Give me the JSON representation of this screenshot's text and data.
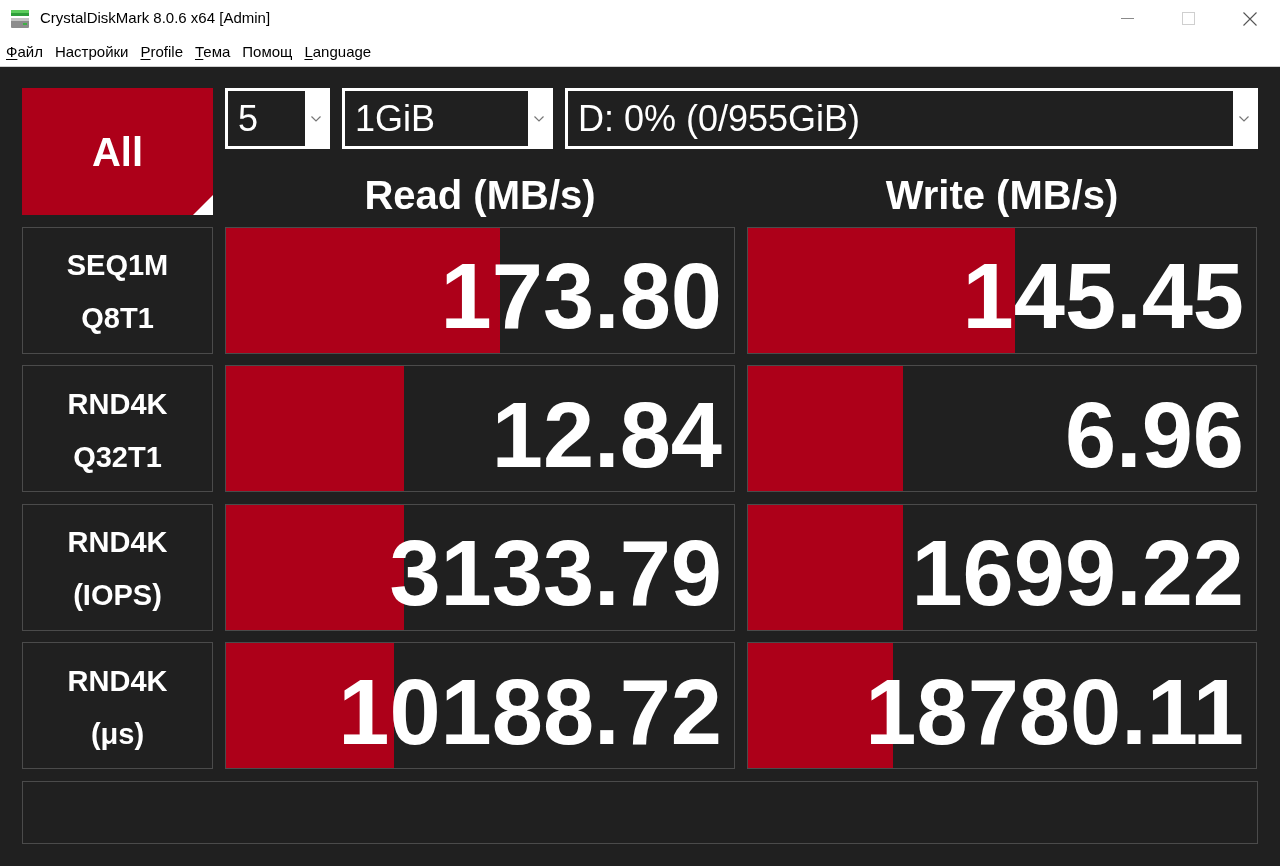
{
  "window": {
    "title": "CrystalDiskMark 8.0.6 x64 [Admin]",
    "maximize_disabled": true
  },
  "menu": [
    {
      "label": "Файл",
      "access_key_underlined": true
    },
    {
      "label": "Настройки",
      "access_key_underlined": false
    },
    {
      "label": "Profile",
      "access_key_underlined": true
    },
    {
      "label": "Тема",
      "access_key_underlined": true
    },
    {
      "label": "Помощ",
      "access_key_underlined": false
    },
    {
      "label": "Language",
      "access_key_underlined": true
    }
  ],
  "controls": {
    "all_button": "All",
    "count": "5",
    "size": "1GiB",
    "drive": "D: 0% (0/955GiB)"
  },
  "columns": [
    "Read (MB/s)",
    "Write (MB/s)"
  ],
  "tests": [
    {
      "label_lines": [
        "SEQ1M",
        "Q8T1"
      ],
      "results": [
        {
          "value": "173.80",
          "level": 0.54
        },
        {
          "value": "145.45",
          "level": 0.525
        }
      ]
    },
    {
      "label_lines": [
        "RND4K",
        "Q32T1"
      ],
      "results": [
        {
          "value": "12.84",
          "level": 0.35
        },
        {
          "value": "6.96",
          "level": 0.305
        }
      ]
    },
    {
      "label_lines": [
        "RND4K",
        "(IOPS)"
      ],
      "results": [
        {
          "value": "3133.79",
          "level": 0.35
        },
        {
          "value": "1699.22",
          "level": 0.305
        }
      ]
    },
    {
      "label_lines": [
        "RND4K",
        "(μs)"
      ],
      "results": [
        {
          "value": "10188.72",
          "level": 0.33
        },
        {
          "value": "18780.11",
          "level": 0.285
        }
      ]
    }
  ]
}
